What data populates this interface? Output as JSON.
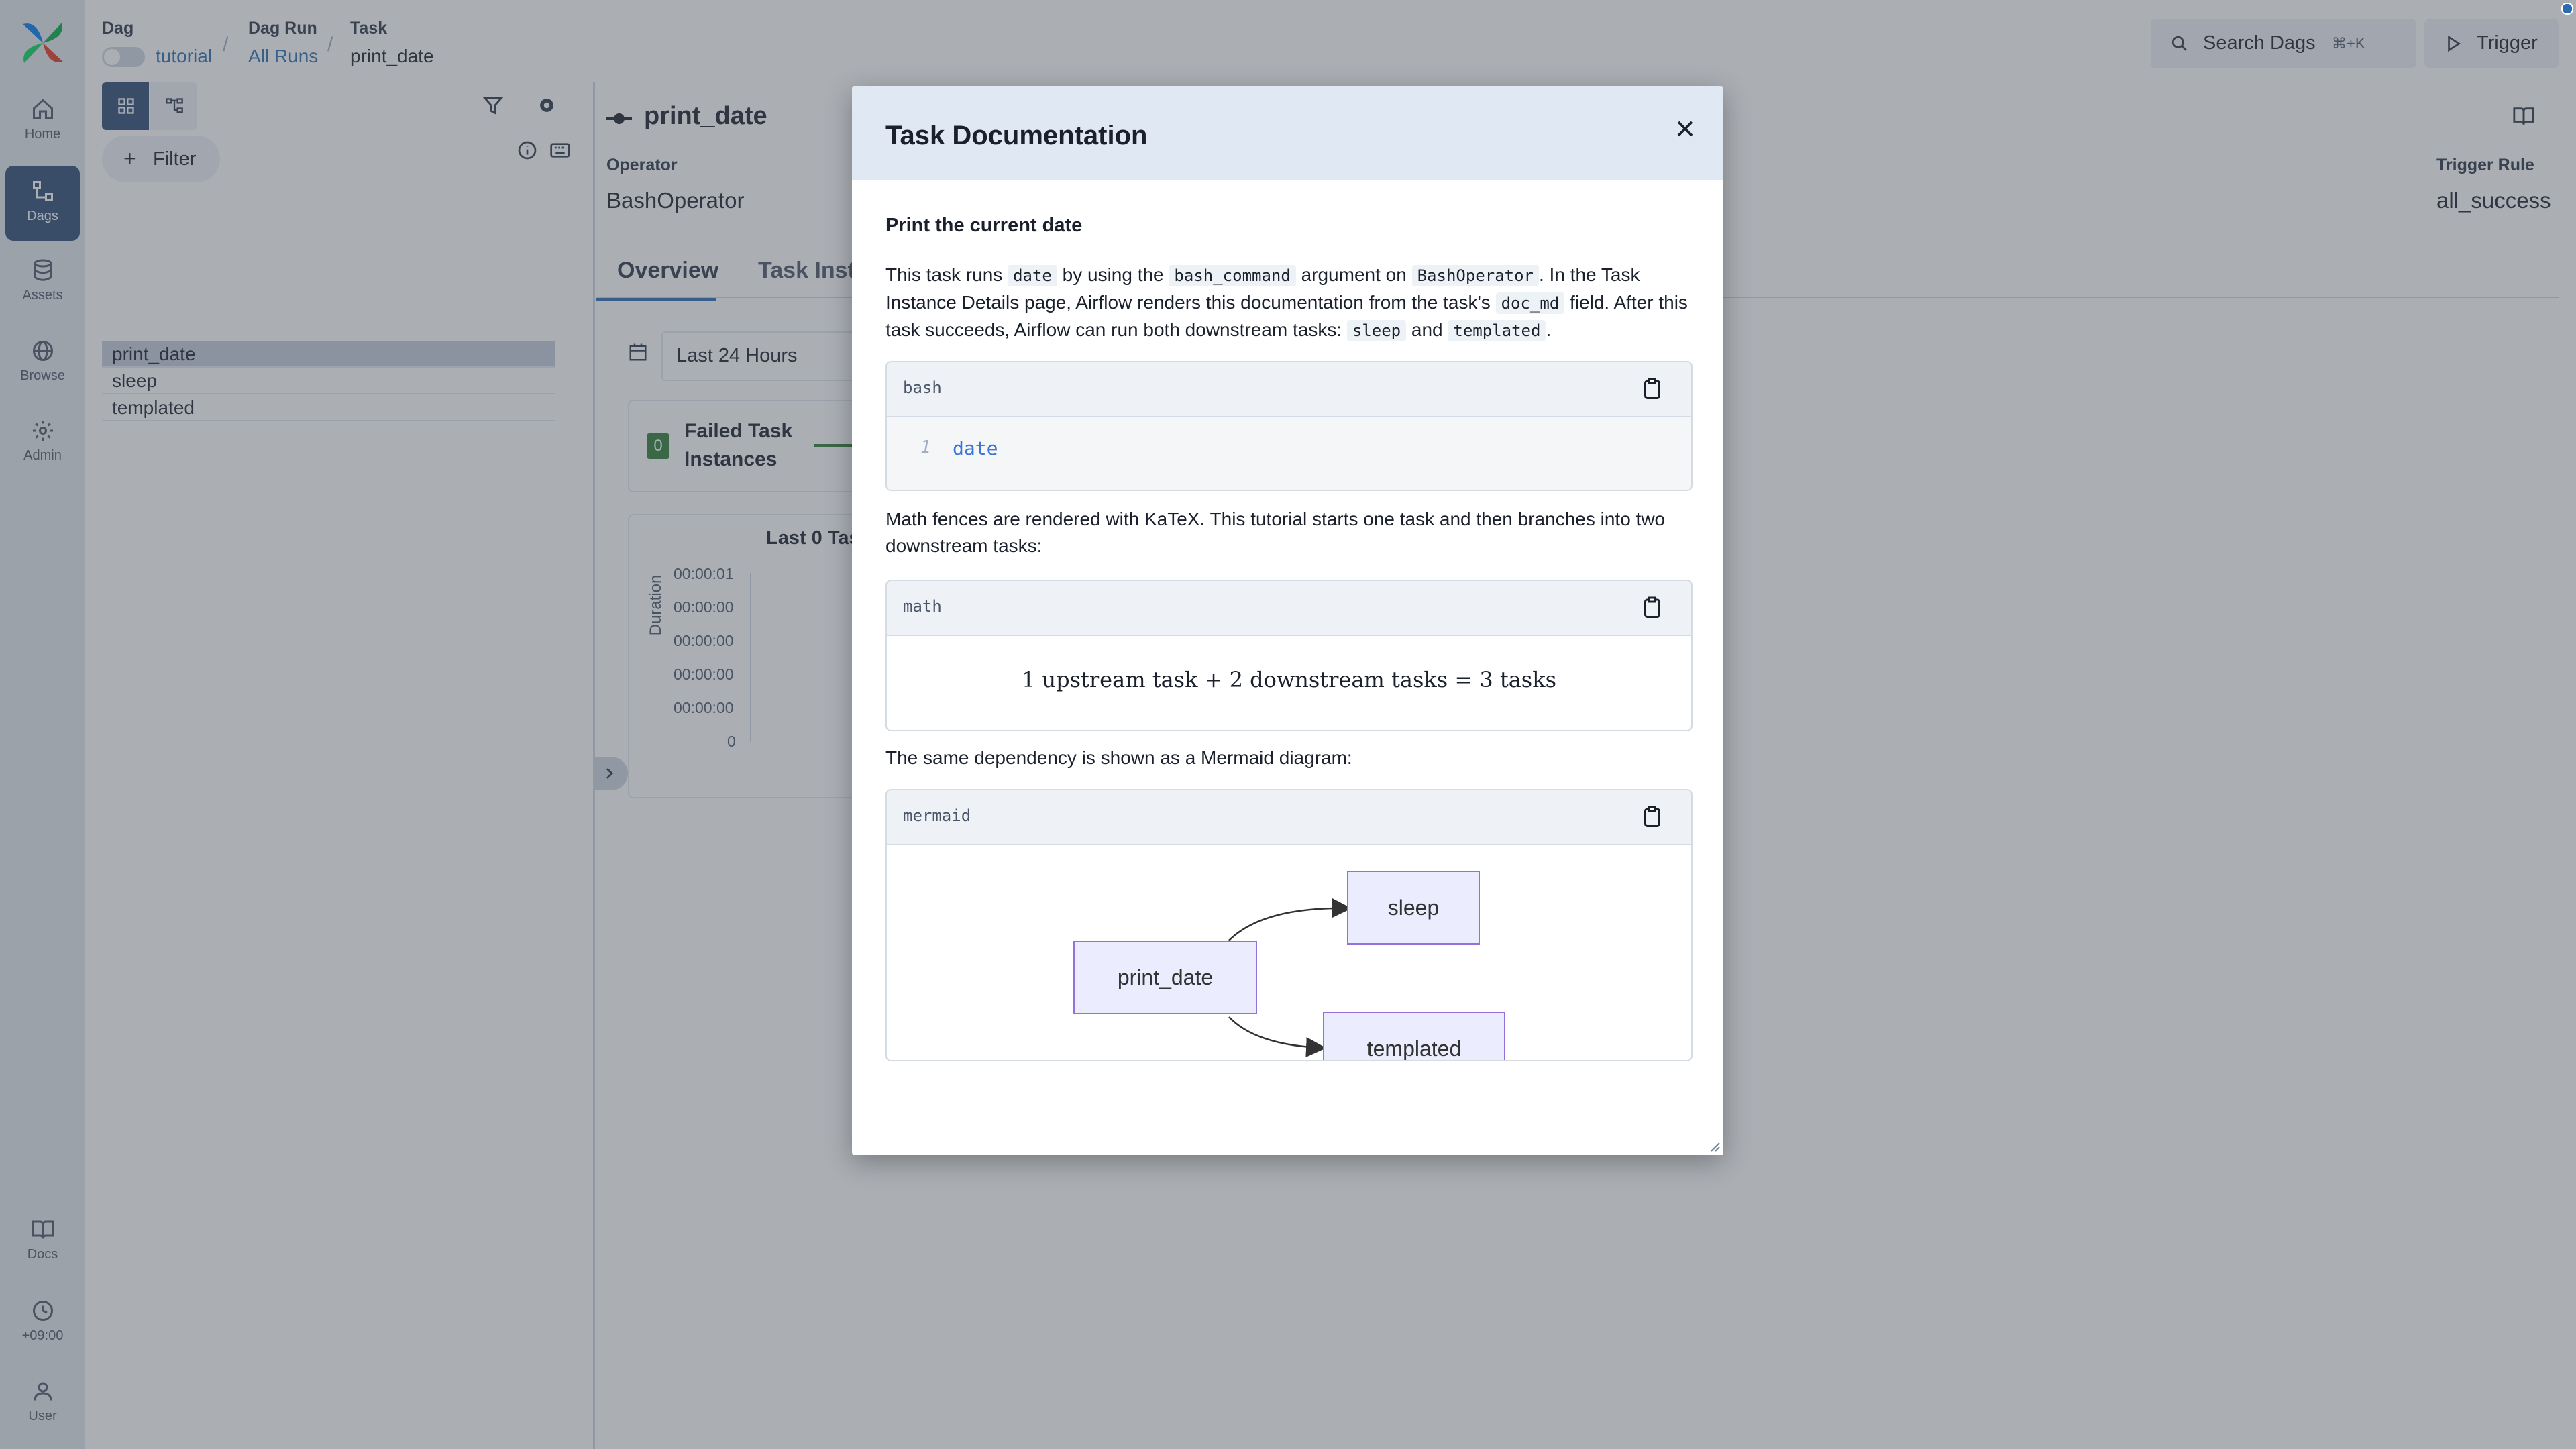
{
  "nav": {
    "items": [
      {
        "label": "Home",
        "icon": "home-icon"
      },
      {
        "label": "Dags",
        "icon": "dags-icon",
        "active": true
      },
      {
        "label": "Assets",
        "icon": "assets-icon"
      },
      {
        "label": "Browse",
        "icon": "globe-icon"
      },
      {
        "label": "Admin",
        "icon": "gear-icon"
      }
    ],
    "bottom": [
      {
        "label": "Docs",
        "icon": "book-icon"
      },
      {
        "label": "+09:00",
        "icon": "clock-icon"
      },
      {
        "label": "User",
        "icon": "user-icon"
      }
    ]
  },
  "header": {
    "breadcrumb": {
      "dag_label": "Dag",
      "dag_value": "tutorial",
      "run_label": "Dag Run",
      "run_value": "All Runs",
      "task_label": "Task",
      "task_value": "print_date"
    },
    "search_label": "Search Dags",
    "search_shortcut": "⌘+K",
    "trigger_label": "Trigger"
  },
  "left_panel": {
    "filter_label": "Filter",
    "tasks": [
      "print_date",
      "sleep",
      "templated"
    ]
  },
  "task": {
    "title": "print_date",
    "operator_label": "Operator",
    "operator_value": "BashOperator",
    "trigger_rule_label": "Trigger Rule",
    "trigger_rule_value": "all_success",
    "tabs": [
      "Overview",
      "Task Insta"
    ],
    "time_range": "Last 24 Hours",
    "failed_count": "0",
    "failed_label_1": "Failed Task",
    "failed_label_2": "Instances",
    "chart_title": "Last 0 Tas",
    "chart_ylabel": "Duration",
    "chart_ticks": [
      "00:00:01",
      "00:00:00",
      "00:00:00",
      "00:00:00",
      "00:00:00",
      "0"
    ]
  },
  "modal": {
    "title": "Task Documentation",
    "heading": "Print the current date",
    "p1": {
      "t1": "This task runs ",
      "c1": "date",
      "t2": " by using the ",
      "c2": "bash_command",
      "t3": " argument on ",
      "c3": "BashOperator",
      "t4": ". In the Task Instance Details page, Airflow renders this documentation from the task's ",
      "c4": "doc_md",
      "t5": " field. After this task succeeds, Airflow can run both downstream tasks: ",
      "c5": "sleep",
      "t6": " and ",
      "c6": "templated",
      "t7": "."
    },
    "bash": {
      "lang": "bash",
      "line_no": "1",
      "code": "date"
    },
    "p2": "Math fences are rendered with KaTeX. This tutorial starts one task and then branches into two downstream tasks:",
    "math": {
      "lang": "math",
      "formula": "1 upstream task + 2 downstream tasks = 3 tasks"
    },
    "p3": "The same dependency is shown as a Mermaid diagram:",
    "mermaid": {
      "lang": "mermaid",
      "nodes": {
        "root": "print_date",
        "a": "sleep",
        "b": "templated"
      }
    }
  }
}
